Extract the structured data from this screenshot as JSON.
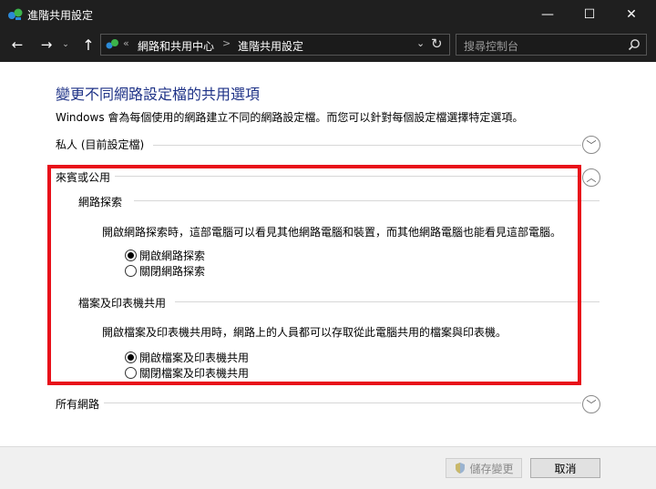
{
  "window": {
    "title": "進階共用設定",
    "controls": {
      "minimize": "—",
      "maximize": "☐",
      "close": "✕"
    }
  },
  "navigation": {
    "back": "←",
    "forward": "→",
    "recent": "⌄",
    "up": "↑",
    "address": {
      "sep0": "«",
      "crumb1": "網路和共用中心",
      "sep1": ">",
      "crumb2": "進階共用設定",
      "dropdown": "⌄",
      "refresh": "↻"
    },
    "search": {
      "placeholder": "搜尋控制台"
    }
  },
  "content": {
    "title": "變更不同網路設定檔的共用選項",
    "description": "Windows 會為每個使用的網路建立不同的網路設定檔。而您可以針對每個設定檔選擇特定選項。",
    "profiles": {
      "private": {
        "label": "私人 (目前設定檔)",
        "state": "collapsed",
        "chevron": "﹀"
      },
      "guest_public": {
        "label": "來賓或公用",
        "state": "expanded",
        "chevron": "︿",
        "network_discovery": {
          "heading": "網路探索",
          "description": "開啟網路探索時，這部電腦可以看見其他網路電腦和裝置，而其他網路電腦也能看見這部電腦。",
          "options": [
            {
              "label": "開啟網路探索",
              "selected": true
            },
            {
              "label": "關閉網路探索",
              "selected": false
            }
          ]
        },
        "file_printer_sharing": {
          "heading": "檔案及印表機共用",
          "description": "開啟檔案及印表機共用時，網路上的人員都可以存取從此電腦共用的檔案與印表機。",
          "options": [
            {
              "label": "開啟檔案及印表機共用",
              "selected": true
            },
            {
              "label": "關閉檔案及印表機共用",
              "selected": false
            }
          ]
        }
      },
      "all_networks": {
        "label": "所有網路",
        "state": "collapsed",
        "chevron": "﹀"
      }
    },
    "highlight_color": "#e8101a",
    "title_color": "#1e3287"
  },
  "footer": {
    "save_label": "儲存變更",
    "cancel_label": "取消"
  }
}
